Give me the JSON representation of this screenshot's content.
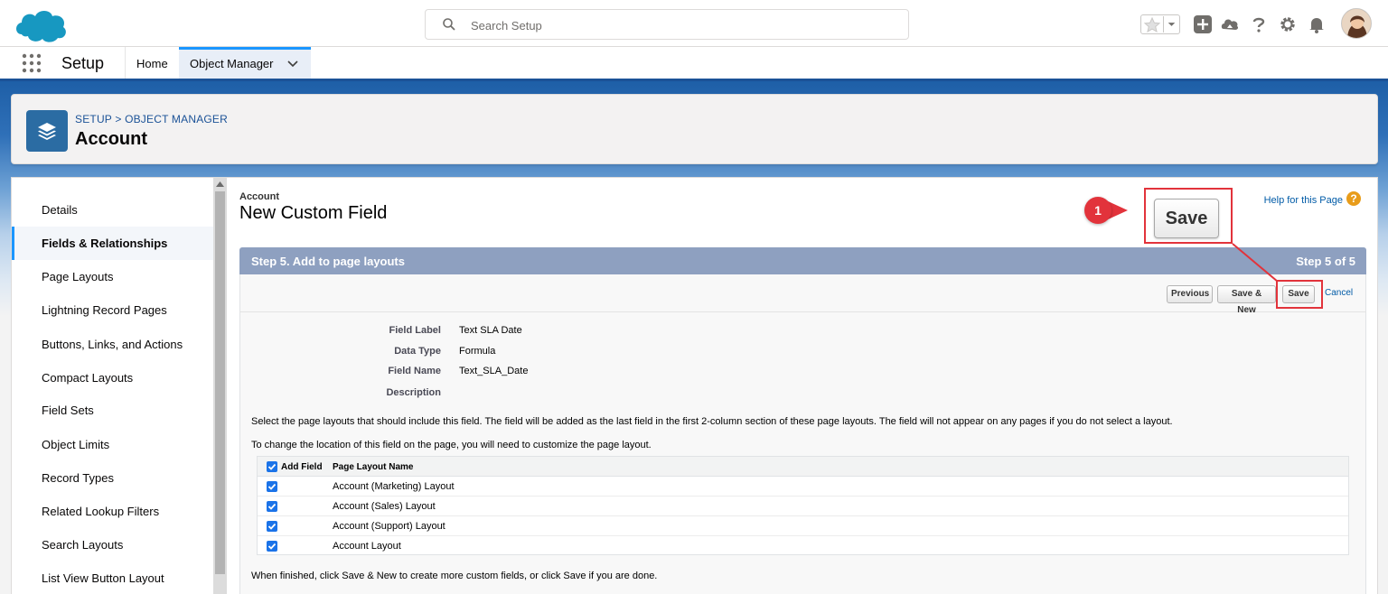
{
  "header": {
    "search_placeholder": "Search Setup"
  },
  "nav": {
    "app_name": "Setup",
    "tabs": [
      {
        "label": "Home"
      },
      {
        "label": "Object Manager"
      }
    ]
  },
  "page_header": {
    "breadcrumb": "SETUP > OBJECT MANAGER",
    "title": "Account"
  },
  "sidebar": {
    "items": [
      {
        "label": "Details"
      },
      {
        "label": "Fields & Relationships"
      },
      {
        "label": "Page Layouts"
      },
      {
        "label": "Lightning Record Pages"
      },
      {
        "label": "Buttons, Links, and Actions"
      },
      {
        "label": "Compact Layouts"
      },
      {
        "label": "Field Sets"
      },
      {
        "label": "Object Limits"
      },
      {
        "label": "Record Types"
      },
      {
        "label": "Related Lookup Filters"
      },
      {
        "label": "Search Layouts"
      },
      {
        "label": "List View Button Layout"
      }
    ],
    "active_index": 1
  },
  "main": {
    "object_label": "Account",
    "title": "New Custom Field",
    "help_link": "Help for this Page",
    "help_icon": "?",
    "step_title": "Step 5. Add to page layouts",
    "step_count": "Step 5 of 5",
    "buttons": {
      "previous": "Previous",
      "save_new": "Save & New",
      "save": "Save",
      "cancel": "Cancel"
    },
    "fields": [
      {
        "label": "Field Label",
        "value": "Text SLA Date"
      },
      {
        "label": "Data Type",
        "value": "Formula"
      },
      {
        "label": "Field Name",
        "value": "Text_SLA_Date"
      },
      {
        "label": "Description",
        "value": ""
      }
    ],
    "para1": "Select the page layouts that should include this field. The field will be added as the last field in the first 2-column section of these page layouts. The field will not appear on any pages if you do not select a layout.",
    "para2": "To change the location of this field on the page, you will need to customize the page layout.",
    "table": {
      "col_add": "Add Field",
      "col_name": "Page Layout Name",
      "rows": [
        {
          "name": "Account (Marketing) Layout",
          "checked": true
        },
        {
          "name": "Account (Sales) Layout",
          "checked": true
        },
        {
          "name": "Account (Support) Layout",
          "checked": true
        },
        {
          "name": "Account Layout",
          "checked": true
        }
      ]
    },
    "footer_text": "When finished, click Save & New to create more custom fields, or click Save if you are done."
  },
  "annotation": {
    "badge": "1",
    "zoom_save_label": "Save",
    "color": "#e2333b"
  },
  "colors": {
    "brand_blue": "#1b96ff",
    "banner_blue": "#1e5fa7",
    "step_bar": "#8ea0c0",
    "link": "#015ba7"
  }
}
